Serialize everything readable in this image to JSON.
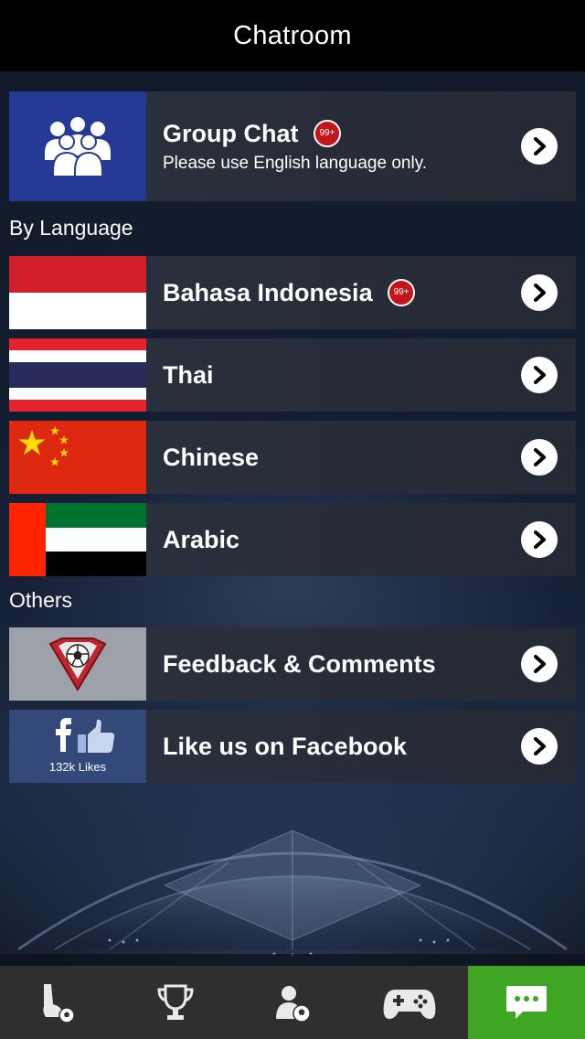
{
  "header": {
    "title": "Chatroom"
  },
  "group_chat": {
    "title": "Group Chat",
    "badge": "99+",
    "subtitle": "Please use English language only.",
    "icon": "people-group-icon"
  },
  "sections": {
    "by_language": "By Language",
    "others": "Others"
  },
  "languages": [
    {
      "label": "Bahasa Indonesia",
      "badge": "99+",
      "flag": "indonesia-flag"
    },
    {
      "label": "Thai",
      "flag": "thailand-flag"
    },
    {
      "label": "Chinese",
      "flag": "china-flag"
    },
    {
      "label": "Arabic",
      "flag": "uae-flag"
    }
  ],
  "others": [
    {
      "label": "Feedback & Comments",
      "icon": "soccer-shield-icon"
    },
    {
      "label": "Like us on Facebook",
      "icon": "facebook-like-icon",
      "likes": "132k Likes"
    }
  ],
  "tabbar": {
    "items": [
      {
        "icon": "football-boot-icon",
        "active": false
      },
      {
        "icon": "trophy-icon",
        "active": false
      },
      {
        "icon": "player-profile-icon",
        "active": false
      },
      {
        "icon": "gamepad-icon",
        "active": false
      },
      {
        "icon": "chat-bubble-icon",
        "active": true
      }
    ]
  },
  "colors": {
    "header_bg": "#000000",
    "row_bg": "#2a2f3b",
    "badge": "#c4151c",
    "active_tab": "#3ea623",
    "group_chat_icon_bg": "#243a94",
    "facebook_blue": "#3b5998"
  }
}
